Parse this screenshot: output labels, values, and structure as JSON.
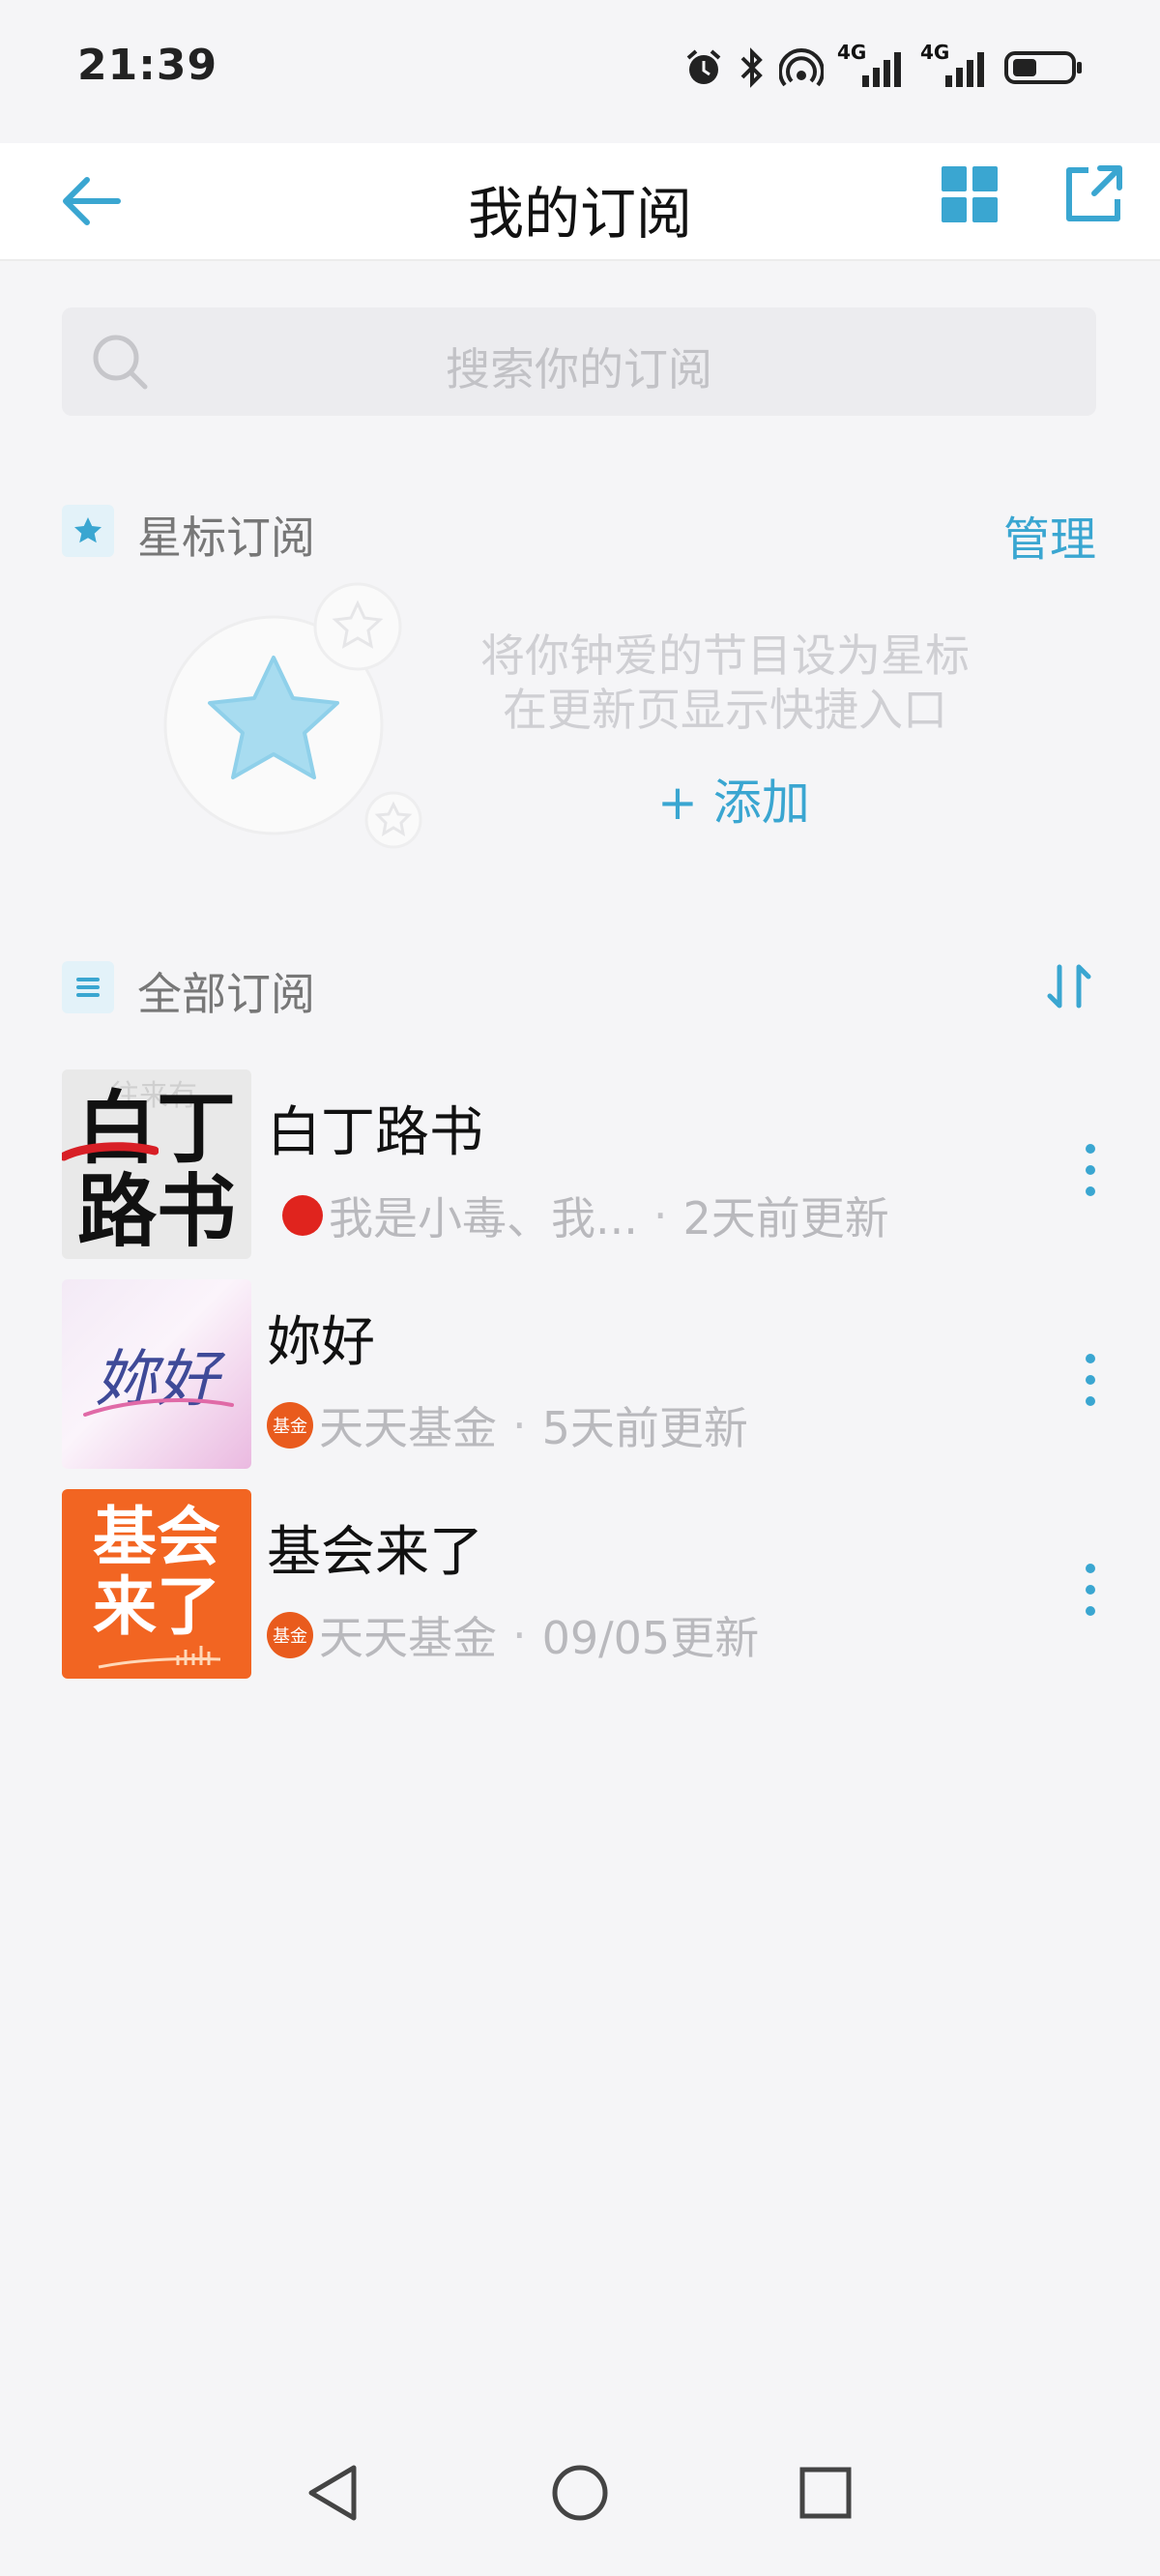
{
  "status": {
    "time": "21:39",
    "network_label_1": "4G",
    "network_label_2": "4G"
  },
  "header": {
    "title": "我的订阅"
  },
  "search": {
    "placeholder": "搜索你的订阅"
  },
  "starred": {
    "title": "星标订阅",
    "manage_label": "管理",
    "empty_line1": "将你钟爱的节目设为星标",
    "empty_line2": "在更新页显示快捷入口",
    "add_label": "+ 添加"
  },
  "all": {
    "title": "全部订阅"
  },
  "subscriptions": [
    {
      "title": "白丁路书",
      "author": "我是小毒、我...",
      "updated": "2天前更新",
      "cover_text_1": "白丁",
      "cover_text_2": "路书",
      "cover_text_top": "往来有"
    },
    {
      "title": "妳好",
      "author": "天天基金",
      "author_badge": "基金",
      "updated": "5天前更新",
      "cover_text": "妳好"
    },
    {
      "title": "基会来了",
      "author": "天天基金",
      "author_badge": "基金",
      "updated": "09/05更新",
      "cover_text_1": "基会",
      "cover_text_2": "来了"
    }
  ],
  "colors": {
    "accent": "#3aa6d1",
    "background": "#f5f5f7",
    "cover_orange": "#f26522"
  }
}
